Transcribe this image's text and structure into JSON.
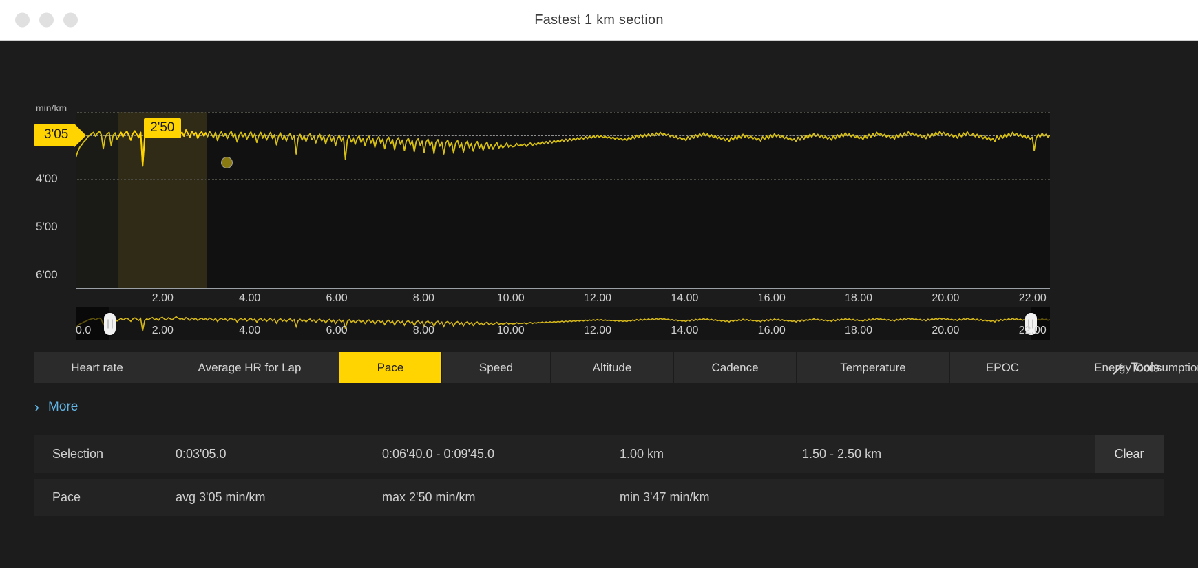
{
  "window": {
    "title": "Fastest 1 km section",
    "controls": [
      "close",
      "minimize",
      "maximize"
    ]
  },
  "chart_data": {
    "type": "line",
    "title": "Fastest 1 km section",
    "xlabel": "",
    "ylabel": "min/km",
    "yunit": "min/km",
    "grid": true,
    "legend": "none",
    "xlim": [
      0.0,
      22.4
    ],
    "ylim_labels": [
      "4'00",
      "5'00",
      "6'00"
    ],
    "y_ticks": [
      {
        "label": "4'00",
        "value": 4.0
      },
      {
        "label": "5'00",
        "value": 5.0
      },
      {
        "label": "6'00",
        "value": 6.0
      }
    ],
    "x_ticks": [
      {
        "label": "2.00",
        "value": 2.0
      },
      {
        "label": "4.00",
        "value": 4.0
      },
      {
        "label": "6.00",
        "value": 6.0
      },
      {
        "label": "8.00",
        "value": 8.0
      },
      {
        "label": "10.00",
        "value": 10.0
      },
      {
        "label": "12.00",
        "value": 12.0
      },
      {
        "label": "14.00",
        "value": 14.0
      },
      {
        "label": "16.00",
        "value": 16.0
      },
      {
        "label": "18.00",
        "value": 18.0
      },
      {
        "label": "20.00",
        "value": 20.0
      },
      {
        "label": "22.00",
        "value": 22.0
      }
    ],
    "navigator_x_ticks": [
      {
        "label": "0.0",
        "value": 0.0
      },
      {
        "label": "2.00",
        "value": 2.0
      },
      {
        "label": "4.00",
        "value": 4.0
      },
      {
        "label": "6.00",
        "value": 6.0
      },
      {
        "label": "8.00",
        "value": 8.0
      },
      {
        "label": "10.00",
        "value": 10.0
      },
      {
        "label": "12.00",
        "value": 12.0
      },
      {
        "label": "14.00",
        "value": 14.0
      },
      {
        "label": "16.00",
        "value": 16.0
      },
      {
        "label": "18.00",
        "value": 18.0
      },
      {
        "label": "20.00",
        "value": 20.0
      },
      {
        "label": "22.00",
        "value": 22.0
      }
    ],
    "average_line": {
      "label": "3'05",
      "value": 3.0833
    },
    "max_marker": {
      "label": "2'50",
      "value": 2.8333,
      "x": 1.95
    },
    "selection_band": {
      "from_km": 1.5,
      "to_km": 2.5
    },
    "series": [
      {
        "name": "Pace",
        "unit": "min/km",
        "color": "#d8c112",
        "values": [
          3.55,
          3.42,
          3.33,
          3.28,
          3.22,
          3.18,
          3.12,
          3.08,
          3.05,
          3.02,
          3.1,
          3.04,
          3.0,
          3.07,
          3.36,
          3.12,
          3.05,
          3.02,
          3.3,
          3.08,
          3.03,
          3.16,
          3.09,
          3.02,
          3.11,
          3.04,
          3.0,
          3.08,
          3.18,
          3.05,
          2.99,
          3.06,
          3.13,
          3.02,
          3.72,
          3.14,
          3.05,
          3.08,
          3.01,
          2.97,
          3.09,
          3.03,
          3.12,
          3.0,
          2.95,
          3.05,
          3.1,
          2.98,
          3.04,
          3.09,
          3.01,
          2.92,
          3.0,
          3.06,
          3.02,
          3.1,
          2.97,
          3.04,
          3.12,
          3.0,
          3.07,
          3.02,
          3.14,
          3.05,
          3.01,
          3.09,
          3.03,
          3.11,
          3.0,
          3.06,
          3.13,
          3.02,
          3.19,
          3.07,
          3.01,
          3.1,
          3.04,
          3.15,
          3.06,
          3.0,
          3.12,
          3.05,
          3.22,
          3.08,
          3.02,
          3.11,
          3.04,
          3.16,
          3.07,
          3.01,
          3.13,
          3.05,
          3.23,
          3.09,
          3.02,
          3.14,
          3.06,
          3.18,
          3.08,
          3.02,
          3.15,
          3.07,
          3.28,
          3.11,
          3.03,
          3.17,
          3.08,
          3.2,
          3.1,
          3.04,
          3.16,
          3.09,
          3.47,
          3.14,
          3.06,
          3.18,
          3.09,
          3.21,
          3.11,
          3.05,
          3.17,
          3.1,
          3.24,
          3.12,
          3.06,
          3.19,
          3.1,
          3.26,
          3.13,
          3.07,
          3.2,
          3.11,
          3.3,
          3.14,
          3.08,
          3.21,
          3.12,
          3.58,
          3.18,
          3.09,
          3.22,
          3.13,
          3.27,
          3.15,
          3.09,
          3.23,
          3.14,
          3.3,
          3.16,
          3.1,
          3.24,
          3.15,
          3.33,
          3.17,
          3.11,
          3.25,
          3.16,
          3.36,
          3.18,
          3.12,
          3.26,
          3.17,
          3.38,
          3.19,
          3.13,
          3.27,
          3.18,
          3.4,
          3.2,
          3.14,
          3.28,
          3.19,
          3.42,
          3.21,
          3.15,
          3.29,
          3.2,
          3.44,
          3.22,
          3.16,
          3.3,
          3.21,
          3.46,
          3.23,
          3.17,
          3.31,
          3.22,
          3.47,
          3.24,
          3.18,
          3.32,
          3.23,
          3.45,
          3.25,
          3.19,
          3.33,
          3.24,
          3.43,
          3.26,
          3.2,
          3.34,
          3.25,
          3.41,
          3.27,
          3.21,
          3.35,
          3.26,
          3.39,
          3.28,
          3.22,
          3.36,
          3.27,
          3.37,
          3.29,
          3.23,
          3.35,
          3.28,
          3.34,
          3.3,
          3.24,
          3.33,
          3.29,
          3.32,
          3.31,
          3.25,
          3.3,
          3.28,
          3.29,
          3.26,
          3.31,
          3.27,
          3.24,
          3.3,
          3.25,
          3.28,
          3.23,
          3.27,
          3.22,
          3.26,
          3.21,
          3.25,
          3.2,
          3.24,
          3.19,
          3.23,
          3.18,
          3.22,
          3.17,
          3.21,
          3.16,
          3.2,
          3.15,
          3.19,
          3.14,
          3.18,
          3.13,
          3.17,
          3.12,
          3.16,
          3.11,
          3.15,
          3.1,
          3.14,
          3.09,
          3.13,
          3.08,
          3.12,
          3.09,
          3.13,
          3.1,
          3.14,
          3.11,
          3.15,
          3.12,
          3.16,
          3.13,
          3.17,
          3.14,
          3.18,
          3.15,
          3.19,
          3.12,
          3.17,
          3.1,
          3.15,
          3.08,
          3.13,
          3.07,
          3.12,
          3.06,
          3.11,
          3.05,
          3.1,
          3.04,
          3.09,
          3.03,
          3.08,
          3.02,
          3.07,
          3.04,
          3.09,
          3.06,
          3.11,
          3.08,
          3.13,
          3.1,
          3.15,
          3.12,
          3.17,
          3.14,
          3.19,
          3.11,
          3.16,
          3.09,
          3.14,
          3.07,
          3.12,
          3.05,
          3.1,
          3.03,
          3.09,
          3.05,
          3.11,
          3.07,
          3.13,
          3.09,
          3.15,
          3.11,
          3.17,
          3.13,
          3.19,
          3.15,
          3.21,
          3.12,
          3.18,
          3.1,
          3.16,
          3.08,
          3.14,
          3.06,
          3.12,
          3.08,
          3.14,
          3.1,
          3.16,
          3.12,
          3.18,
          3.14,
          3.2,
          3.11,
          3.17,
          3.09,
          3.15,
          3.07,
          3.13,
          3.05,
          3.11,
          3.07,
          3.13,
          3.09,
          3.15,
          3.11,
          3.17,
          3.13,
          3.19,
          3.15,
          3.21,
          3.12,
          3.18,
          3.1,
          3.16,
          3.08,
          3.14,
          3.06,
          3.12,
          3.04,
          3.1,
          3.06,
          3.12,
          3.08,
          3.14,
          3.1,
          3.16,
          3.12,
          3.18,
          3.09,
          3.15,
          3.07,
          3.13,
          3.05,
          3.11,
          3.03,
          3.09,
          3.05,
          3.11,
          3.07,
          3.13,
          3.09,
          3.15,
          3.11,
          3.17,
          3.08,
          3.14,
          3.06,
          3.12,
          3.04,
          3.1,
          3.02,
          3.08,
          3.04,
          3.1,
          3.06,
          3.12,
          3.08,
          3.14,
          3.1,
          3.16,
          3.07,
          3.13,
          3.05,
          3.11,
          3.03,
          3.09,
          3.01,
          3.07,
          3.03,
          3.09,
          3.05,
          3.11,
          3.07,
          3.13,
          3.09,
          3.15,
          3.06,
          3.12,
          3.04,
          3.1,
          3.02,
          3.08,
          3.0,
          3.06,
          3.02,
          3.08,
          3.04,
          3.1,
          3.06,
          3.12,
          3.08,
          3.14,
          3.05,
          3.11,
          3.03,
          3.09,
          3.01,
          3.07,
          3.09,
          3.04,
          3.11,
          3.06,
          3.13,
          3.08,
          3.15,
          3.1,
          3.17,
          3.12,
          3.19,
          3.14,
          3.21,
          3.1,
          3.16,
          3.08,
          3.14,
          3.06,
          3.12,
          3.04,
          3.1,
          3.02,
          3.08,
          3.04,
          3.1,
          3.06,
          3.12,
          3.08,
          3.14,
          3.1,
          3.16,
          3.12,
          3.4,
          3.14,
          3.06,
          3.12,
          3.04,
          3.1,
          3.06,
          3.12,
          3.08
        ]
      }
    ]
  },
  "tabs": [
    {
      "id": "heart-rate",
      "label": "Heart rate",
      "active": false
    },
    {
      "id": "average-hr-for-lap",
      "label": "Average HR for Lap",
      "active": false
    },
    {
      "id": "pace",
      "label": "Pace",
      "active": true
    },
    {
      "id": "speed",
      "label": "Speed",
      "active": false
    },
    {
      "id": "altitude",
      "label": "Altitude",
      "active": false
    },
    {
      "id": "cadence",
      "label": "Cadence",
      "active": false
    },
    {
      "id": "temperature",
      "label": "Temperature",
      "active": false
    },
    {
      "id": "epoc",
      "label": "EPOC",
      "active": false
    },
    {
      "id": "energy-consumption",
      "label": "Energy Consumption",
      "active": false
    }
  ],
  "tools": {
    "label": "Tools",
    "icon": "wrench-icon"
  },
  "more": {
    "label": "More",
    "icon": "chevron-right-icon"
  },
  "stats": {
    "selection": {
      "label": "Selection",
      "duration": "0:03'05.0",
      "time_range": "0:06'40.0 - 0:09'45.0",
      "distance": "1.00 km",
      "distance_range": "1.50 - 2.50 km",
      "clear_label": "Clear"
    },
    "pace": {
      "label": "Pace",
      "avg": "avg 3'05 min/km",
      "max": "max 2'50 min/km",
      "min": "min 3'47 min/km"
    }
  },
  "colors": {
    "accent": "#ffd400",
    "line": "#d8c112",
    "link": "#63b7e8",
    "background": "#1c1c1c",
    "plot_background": "#111111"
  }
}
